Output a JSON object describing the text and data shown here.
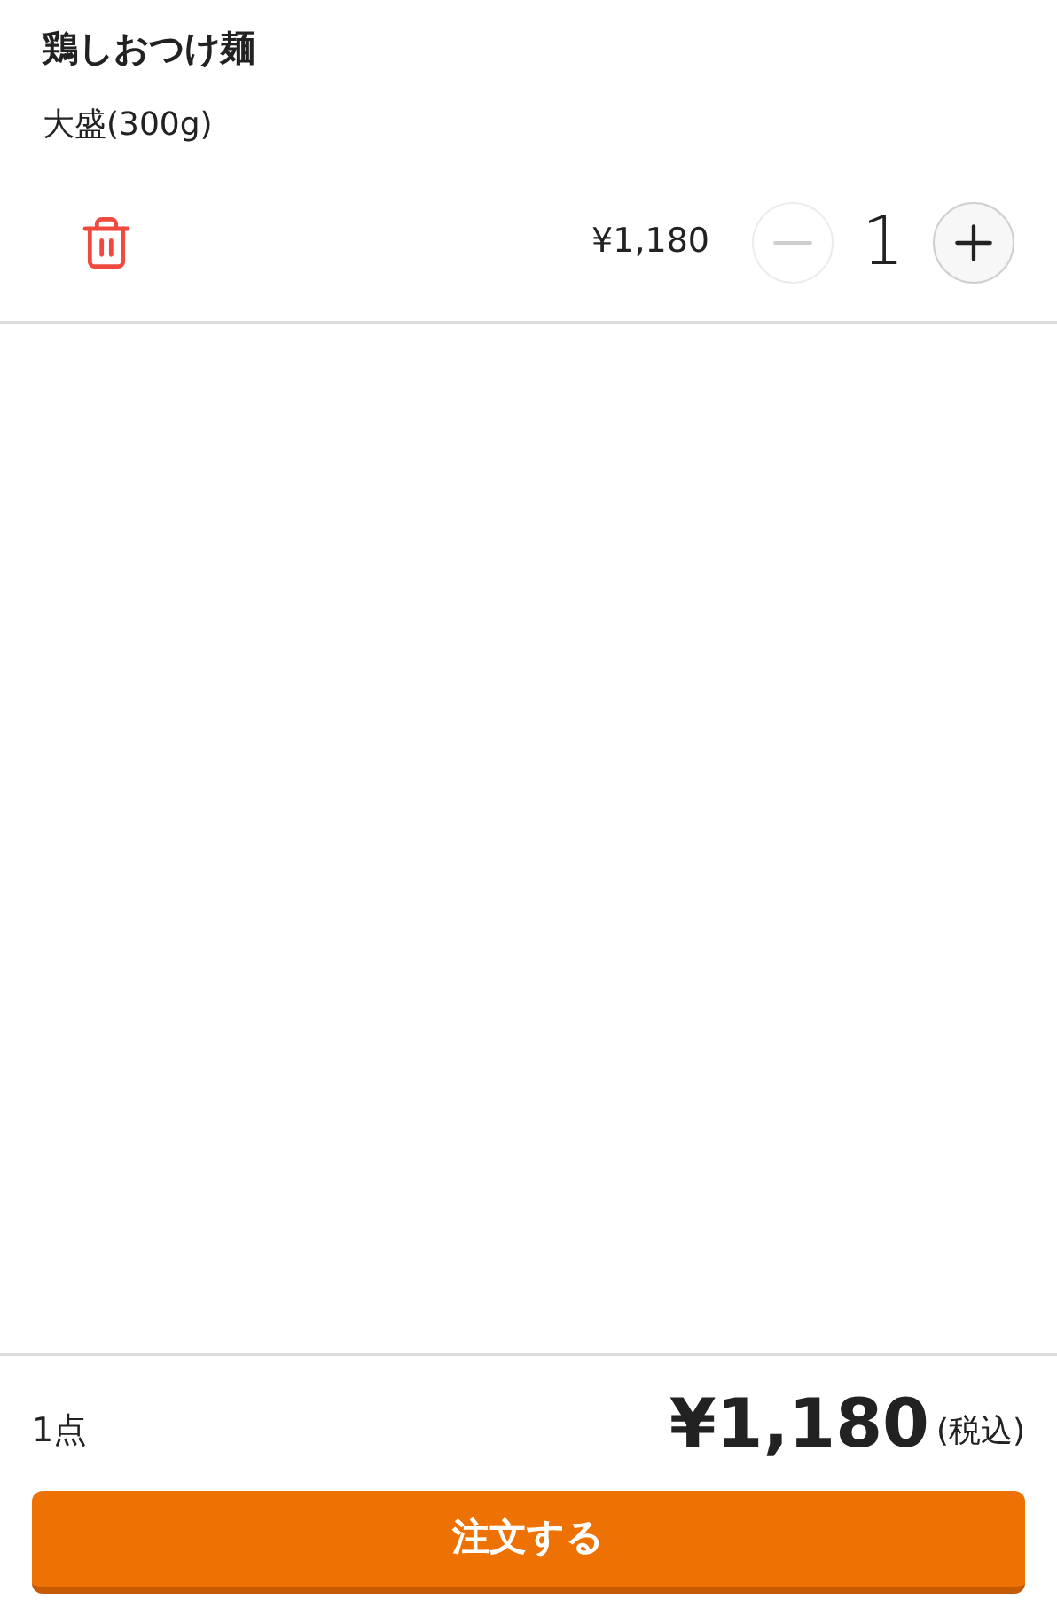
{
  "cart_items": [
    {
      "name": "鶏しおつけ麺",
      "option": "大盛(300g)",
      "price": "¥1,180",
      "quantity": "1",
      "decrement_disabled": true,
      "increment_disabled": false
    }
  ],
  "footer": {
    "count": "1点",
    "total": "¥1,180",
    "tax_note": "(税込)",
    "order_button": "注文する"
  }
}
